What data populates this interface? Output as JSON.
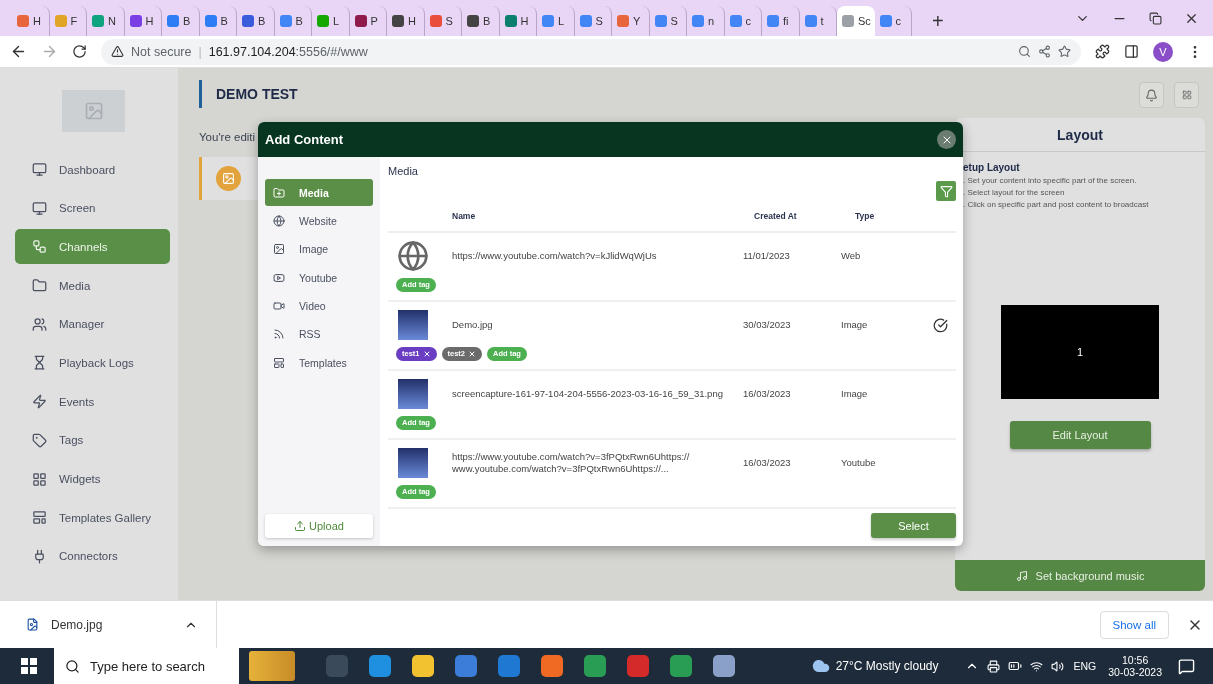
{
  "browser": {
    "tabs": [
      {
        "title": "H",
        "color": "#e8663d",
        "selected": false
      },
      {
        "title": "F",
        "color": "#e0a526",
        "selected": false
      },
      {
        "title": "N",
        "color": "#10a37f",
        "selected": false
      },
      {
        "title": "H",
        "color": "#7a3fe4",
        "selected": false
      },
      {
        "title": "B",
        "color": "#2f7df6",
        "selected": false
      },
      {
        "title": "B",
        "color": "#2f7df6",
        "selected": false
      },
      {
        "title": "B",
        "color": "#3b5bdb",
        "selected": false
      },
      {
        "title": "B",
        "color": "#4285f4",
        "selected": false
      },
      {
        "title": "L",
        "color": "#14a800",
        "selected": false
      },
      {
        "title": "P",
        "color": "#8e1b4b",
        "selected": false
      },
      {
        "title": "H",
        "color": "#444444",
        "selected": false
      },
      {
        "title": "S",
        "color": "#e94e3c",
        "selected": false
      },
      {
        "title": "B",
        "color": "#444444",
        "selected": false
      },
      {
        "title": "H",
        "color": "#0d7f6f",
        "selected": false
      },
      {
        "title": "L",
        "color": "#4285f4",
        "selected": false
      },
      {
        "title": "S",
        "color": "#4285f4",
        "selected": false
      },
      {
        "title": "Y",
        "color": "#e8663d",
        "selected": false
      },
      {
        "title": "S",
        "color": "#4285f4",
        "selected": false
      },
      {
        "title": "n",
        "color": "#4285f4",
        "selected": false
      },
      {
        "title": "c",
        "color": "#4285f4",
        "selected": false
      },
      {
        "title": "fi",
        "color": "#4285f4",
        "selected": false
      },
      {
        "title": "t",
        "color": "#4285f4",
        "selected": false
      },
      {
        "title": "Sc",
        "color": "#9aa0a6",
        "selected": true
      },
      {
        "title": "c",
        "color": "#4285f4",
        "selected": false
      }
    ],
    "new_tab": "+",
    "security": "Not secure",
    "separator": "|",
    "host": "161.97.104.204",
    "path": ":5556/#/www",
    "profile": "V"
  },
  "sidebar": {
    "items": [
      {
        "label": "Dashboard",
        "selected": false
      },
      {
        "label": "Screen",
        "selected": false
      },
      {
        "label": "Channels",
        "selected": true
      },
      {
        "label": "Media",
        "selected": false
      },
      {
        "label": "Manager",
        "selected": false
      },
      {
        "label": "Playback Logs",
        "selected": false
      },
      {
        "label": "Events",
        "selected": false
      },
      {
        "label": "Tags",
        "selected": false
      },
      {
        "label": "Widgets",
        "selected": false
      },
      {
        "label": "Templates Gallery",
        "selected": false
      },
      {
        "label": "Connectors",
        "selected": false
      }
    ]
  },
  "page": {
    "title": "DEMO TEST",
    "editing_note": "You're editi"
  },
  "layout_panel": {
    "title": "Layout",
    "setup_title": "etup Layout",
    "steps": [
      ". Set your content into specific part of the screen.",
      ". Select layout for the screen",
      ". Click on specific part and post content to broadcast"
    ],
    "zones": [
      "1"
    ],
    "edit_button": "Edit Layout",
    "music_button": "Set background music"
  },
  "modal": {
    "title": "Add Content",
    "categories": [
      {
        "label": "Media",
        "selected": true
      },
      {
        "label": "Website",
        "selected": false
      },
      {
        "label": "Image",
        "selected": false
      },
      {
        "label": "Youtube",
        "selected": false
      },
      {
        "label": "Video",
        "selected": false
      },
      {
        "label": "RSS",
        "selected": false
      },
      {
        "label": "Templates",
        "selected": false
      }
    ],
    "upload_button": "Upload",
    "section_title": "Media",
    "columns": [
      "Name",
      "Created At",
      "Type"
    ],
    "rows": [
      {
        "kind": "web",
        "name": "https://www.youtube.com/watch?v=kJlidWqWjUs",
        "created_at": "11/01/2023",
        "type": "Web",
        "selected": false,
        "tags": [
          {
            "kind": "add",
            "label": "Add tag",
            "color": "#4caf50"
          }
        ]
      },
      {
        "kind": "image",
        "name": "Demo.jpg",
        "created_at": "30/03/2023",
        "type": "Image",
        "selected": true,
        "tags": [
          {
            "kind": "tag",
            "label": "test1",
            "color": "#6a3dc2"
          },
          {
            "kind": "tag",
            "label": "test2",
            "color": "#6b6b6b"
          },
          {
            "kind": "add",
            "label": "Add tag",
            "color": "#4caf50"
          }
        ]
      },
      {
        "kind": "image",
        "name": "screencapture-161-97-104-204-5556-2023-03-16-16_59_31.png",
        "created_at": "16/03/2023",
        "type": "Image",
        "selected": false,
        "tags": [
          {
            "kind": "add",
            "label": "Add tag",
            "color": "#4caf50"
          }
        ]
      },
      {
        "kind": "image",
        "name": "https://www.youtube.com/watch?v=3fPQtxRwn6Uhttps:// www.youtube.com/watch?v=3fPQtxRwn6Uhttps://...",
        "created_at": "16/03/2023",
        "type": "Youtube",
        "selected": false,
        "tags": [
          {
            "kind": "add",
            "label": "Add tag",
            "color": "#4caf50"
          }
        ]
      }
    ],
    "select_button": "Select"
  },
  "downloads": {
    "items": [
      {
        "name": "Demo.jpg"
      }
    ],
    "show_all": "Show all"
  },
  "taskbar": {
    "search_placeholder": "Type here to search",
    "weather": "27°C Mostly cloudy",
    "language": "ENG",
    "time": "10:56",
    "date": "30-03-2023"
  }
}
